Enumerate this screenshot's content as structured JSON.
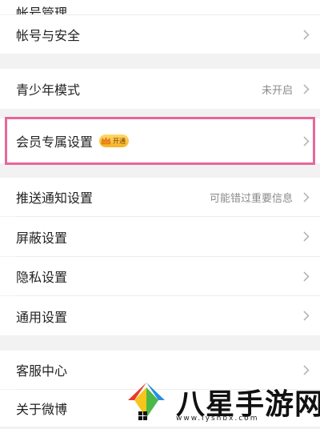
{
  "settings": {
    "top_partial_label": "帐号管理",
    "account_security": "帐号与安全",
    "youth_mode": {
      "label": "青少年模式",
      "value": "未开启"
    },
    "vip_settings": {
      "label": "会员专属设置",
      "badge": "开通"
    },
    "push_notifications": {
      "label": "推送通知设置",
      "value": "可能错过重要信息"
    },
    "block_settings": "屏蔽设置",
    "privacy_settings": "隐私设置",
    "general_settings": "通用设置",
    "customer_service": "客服中心",
    "about_weibo": "关于微博"
  },
  "watermark": {
    "title": "八星手游网",
    "url": "www.lyshbx.com"
  },
  "colors": {
    "highlight_border": "#e8679a",
    "page_background": "#f2f2f2",
    "row_background": "#ffffff",
    "chevron": "#b5b5b5"
  }
}
